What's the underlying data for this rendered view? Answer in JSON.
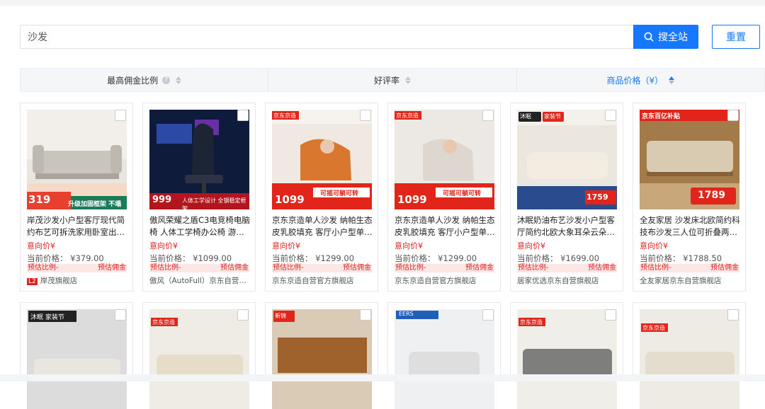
{
  "search": {
    "value": "沙发",
    "button_label": "搜全站",
    "reset_label": "重置"
  },
  "sort": [
    {
      "label": "最高佣金比例"
    },
    {
      "label": "好评率"
    },
    {
      "label": "商品价格（¥）"
    }
  ],
  "products": [
    {
      "title": "岸茂沙发小户型客厅现代简约布艺可拆洗家用卧室出…",
      "intent": "意向价¥",
      "price_label": "当前价格：",
      "price": "¥379.00",
      "ratio_label": "预估比例-",
      "commission_label": "预估佣金",
      "shop_badge": "L2",
      "shop": "岸茂旗舰店",
      "image_text": [
        "319",
        "升级加固框架 不塌陷"
      ]
    },
    {
      "title": "傲风荣耀之盾C3电竞椅电脑椅 人体工学椅办公椅 游…",
      "intent": "意向价¥",
      "price_label": "当前价格：",
      "price": "¥1099.00",
      "ratio_label": "预估比例-",
      "commission_label": "预估佣金",
      "shop": "傲风（AutoFull）京东自营…",
      "image_text": [
        "999",
        "人体工学设计 全钢稳定框架"
      ]
    },
    {
      "title": "京东京造单人沙发 纳帕生态皮乳胶填充 客厅小户型单…",
      "intent": "意向价¥",
      "price_label": "当前价格：",
      "price": "¥1299.00",
      "ratio_label": "预估比例-",
      "commission_label": "预估佣金",
      "shop": "京东京造自营官方旗舰店",
      "image_text": [
        "京东京造",
        "1099",
        "可摇可躺可转"
      ]
    },
    {
      "title": "京东京造单人沙发 纳帕生态皮乳胶填充 客厅小户型单…",
      "intent": "意向价¥",
      "price_label": "当前价格：",
      "price": "¥1299.00",
      "ratio_label": "预估比例-",
      "commission_label": "预估佣金",
      "shop": "京东京造自营官方旗舰店",
      "image_text": [
        "京东京造",
        "1099",
        "可摇可躺可转"
      ]
    },
    {
      "title": "沐眠奶油布艺沙发小户型客厅简约北欧大象耳朵云朵…",
      "intent": "意向价¥",
      "price_label": "当前价格：",
      "price": "¥1699.00",
      "ratio_label": "预估比例-",
      "commission_label": "预估佣金",
      "shop": "居家优选京东自营旗舰店",
      "image_text": [
        "沐眠",
        "家装节",
        "1759"
      ]
    },
    {
      "title": "全友家居 沙发床北欧简约科技布沙发三人位可折叠两…",
      "intent": "意向价¥",
      "price_label": "当前价格：",
      "price": "¥1788.50",
      "ratio_label": "预估比例-",
      "commission_label": "预估佣金",
      "shop": "全友家居京东自营旗舰店",
      "image_text": [
        "京东百亿补贴",
        "1789"
      ]
    }
  ],
  "row2_labels": [
    "沐眠 家装节",
    "京东京造",
    "新锦",
    "EERS",
    "京东京造",
    "京东京造"
  ],
  "colors": {
    "accent": "#1677ff",
    "price_red": "#e02020"
  }
}
